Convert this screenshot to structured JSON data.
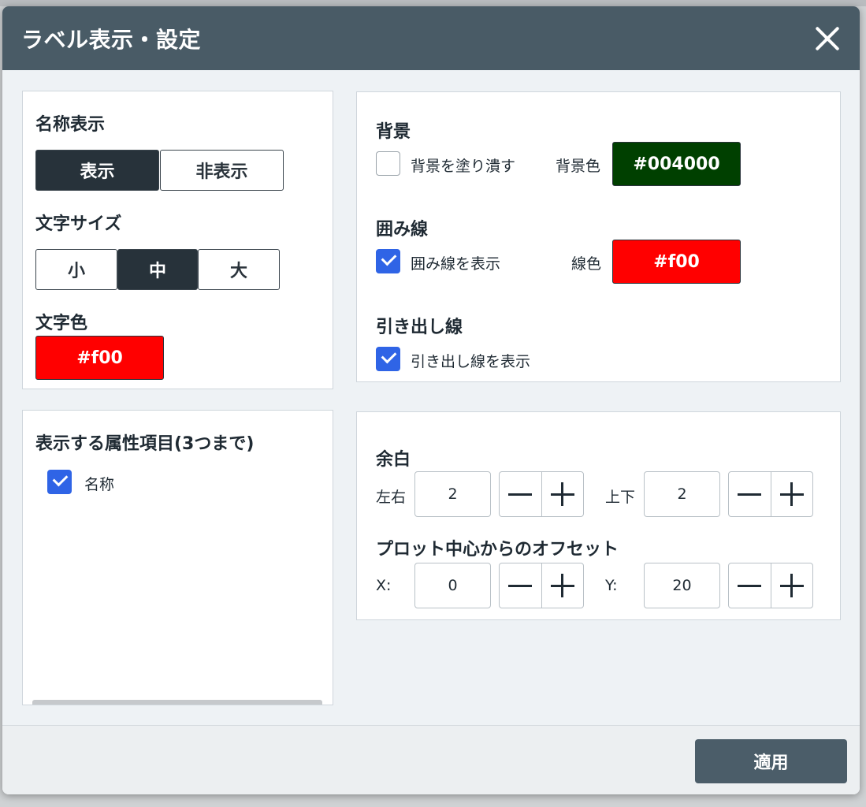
{
  "dialog": {
    "title": "ラベル表示・設定",
    "close_label": "×"
  },
  "name_display": {
    "heading": "名称表示",
    "options": [
      "表示",
      "非表示"
    ],
    "selected": "表示"
  },
  "font_size": {
    "heading": "文字サイズ",
    "options": [
      "小",
      "中",
      "大"
    ],
    "selected": "中"
  },
  "font_color": {
    "heading": "文字色",
    "value": "#f00",
    "swatch_color": "#ff0000"
  },
  "attributes": {
    "heading": "表示する属性項目(3つまで)",
    "items": [
      {
        "label": "名称",
        "checked": true
      }
    ]
  },
  "background": {
    "heading": "背景",
    "fill_label": "背景を塗り潰す",
    "fill_checked": false,
    "color_label": "背景色",
    "color_value": "#004000",
    "swatch_color": "#004000"
  },
  "border": {
    "heading": "囲み線",
    "show_label": "囲み線を表示",
    "show_checked": true,
    "color_label": "線色",
    "color_value": "#f00",
    "swatch_color": "#ff0000"
  },
  "leader": {
    "heading": "引き出し線",
    "show_label": "引き出し線を表示",
    "show_checked": true
  },
  "padding": {
    "heading": "余白",
    "horizontal_label": "左右",
    "horizontal_value": "2",
    "vertical_label": "上下",
    "vertical_value": "2"
  },
  "offset": {
    "heading": "プロット中心からのオフセット",
    "x_label": "X:",
    "x_value": "0",
    "y_label": "Y:",
    "y_value": "20"
  },
  "footer": {
    "apply_label": "適用"
  },
  "colors": {
    "header_bg": "#495b66",
    "accent_check": "#2f64e6",
    "active_seg": "#27323a"
  }
}
